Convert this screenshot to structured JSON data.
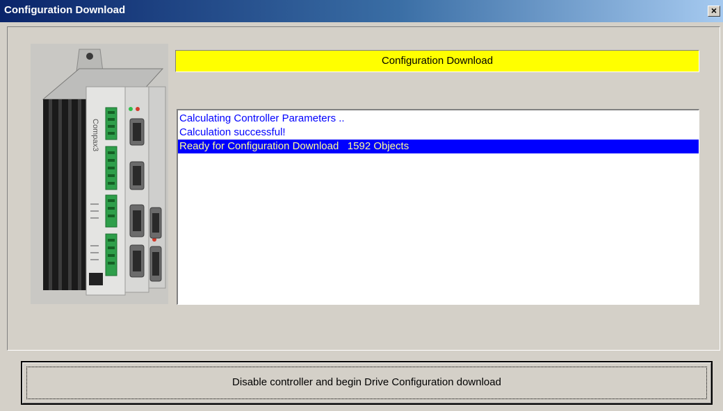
{
  "window": {
    "title": "Configuration Download",
    "close_glyph": "×",
    "close_icon": "close-icon"
  },
  "header": {
    "banner_text": "Configuration Download",
    "banner_color": "#ffff00"
  },
  "log": {
    "lines": [
      "Calculating Controller Parameters ..",
      "Calculation successful!",
      "Ready for Configuration Download   1592 Objects"
    ],
    "selected_index": 2,
    "text_color": "#0000ff",
    "selected_bg": "#0000ff",
    "selected_text_color": "#ffff99"
  },
  "device": {
    "brand_label": "Compax3"
  },
  "action": {
    "button_label": "Disable controller and begin Drive Configuration download"
  }
}
